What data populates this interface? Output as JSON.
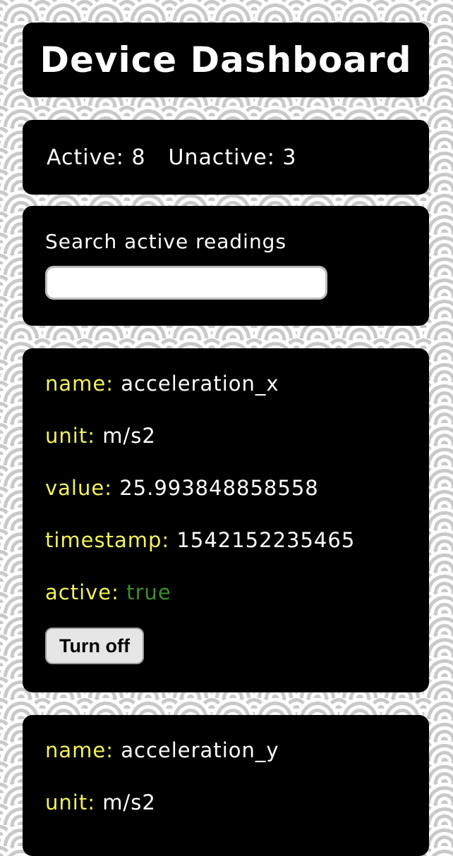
{
  "header": {
    "title": "Device Dashboard"
  },
  "counts": {
    "active": "Active: 8",
    "unactive": "Unactive: 3"
  },
  "search": {
    "label": "Search active readings",
    "value": "",
    "placeholder": ""
  },
  "labels": {
    "name": "name:",
    "unit": "unit:",
    "value": "value:",
    "timestamp": "timestamp:",
    "active": "active:"
  },
  "readings": [
    {
      "name": "acceleration_x",
      "unit": "m/s2",
      "value": "25.993848858558",
      "timestamp": "1542152235465",
      "active": "true",
      "button_label": "Turn off"
    },
    {
      "name": "acceleration_y",
      "unit": "m/s2"
    }
  ],
  "colors": {
    "card_background": "#000000",
    "field_key": "#f4f25a",
    "active_true": "#3e8e2e",
    "text": "#ffffff"
  }
}
